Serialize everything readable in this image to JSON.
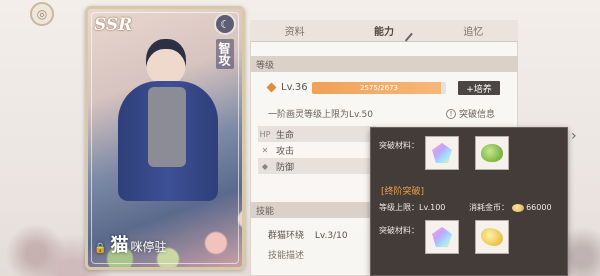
{
  "card": {
    "rarity": "SSR",
    "attribute": "智攻",
    "name_big": "猫",
    "name_small": "咪停驻"
  },
  "tabs": [
    {
      "label": "资料"
    },
    {
      "label": "能力"
    },
    {
      "label": "追忆"
    }
  ],
  "level_section": {
    "header": "等级",
    "level": "Lv.36",
    "xp": "2575/2673",
    "xp_fraction": 0.963,
    "train_label": "+培养",
    "limit_text": "一阶画灵等级上限为Lv.50",
    "break_info_label": "突破信息"
  },
  "stats": [
    {
      "icon": "HP",
      "label": "生命"
    },
    {
      "icon": "✕",
      "label": "攻击"
    },
    {
      "icon": "◆",
      "label": "防御"
    }
  ],
  "skill_section": {
    "header": "技能",
    "skill_name": "群猫环绕",
    "skill_level": "Lv.3/10",
    "desc_label": "技能描述"
  },
  "popup": {
    "materials_label_1": "突破材料：",
    "final_break_title": "[终阶突破]",
    "level_cap": "等级上限：Lv.100",
    "gold_label": "消耗金币：",
    "gold_value": "66000",
    "materials_label_2": "突破材料："
  },
  "colors": {
    "accent_orange": "#f0a257",
    "popup_bg": "#433c39",
    "popup_title": "#e9a04d"
  }
}
